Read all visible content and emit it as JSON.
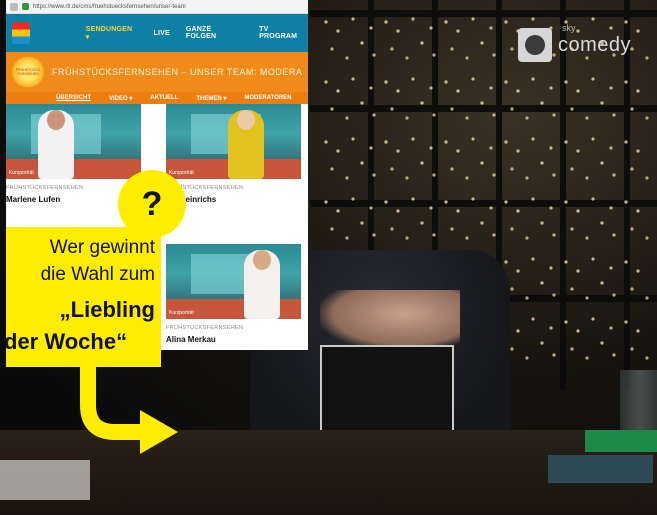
{
  "browser": {
    "url": "https://www.rtl.de/cms/fruehstuecksfernsehen/unser-team",
    "nav": [
      "SENDUNGEN ▾",
      "LIVE",
      "GANZE FOLGEN",
      "TV PROGRAM"
    ],
    "banner_title": "FRÜHSTÜCKSFERNSEHEN – UNSER TEAM: MODERA",
    "logo_text": "FRÜHSTÜCKS FERNSEHEN",
    "subnav": [
      "ÜBERSICHT",
      "VIDEO ▾",
      "AKTUELL",
      "THEMEN ▾",
      "MODERATOREN"
    ],
    "cards": [
      {
        "kicker": "FRÜHSTÜCKSFERNSEHEN",
        "name": "Marlene Lufen",
        "tag": "Kurzporträt"
      },
      {
        "kicker": "FRÜHSTÜCKSFERNSEHEN",
        "name": "...n Heinrichs",
        "tag": "Kurzporträt"
      },
      {
        "kicker": "FRÜHSTÜCKSFERNSEHEN",
        "name": "Alina Merkau",
        "tag": "Kurzporträt"
      }
    ]
  },
  "overlay": {
    "question_mark": "?",
    "line1": "Wer gewinnt",
    "line2": "die Wahl zum",
    "line3": "„Liebling",
    "line4": "der Woche“",
    "color": "#ffed00"
  },
  "channel_logo": {
    "text": "comedy",
    "small": "sky"
  }
}
